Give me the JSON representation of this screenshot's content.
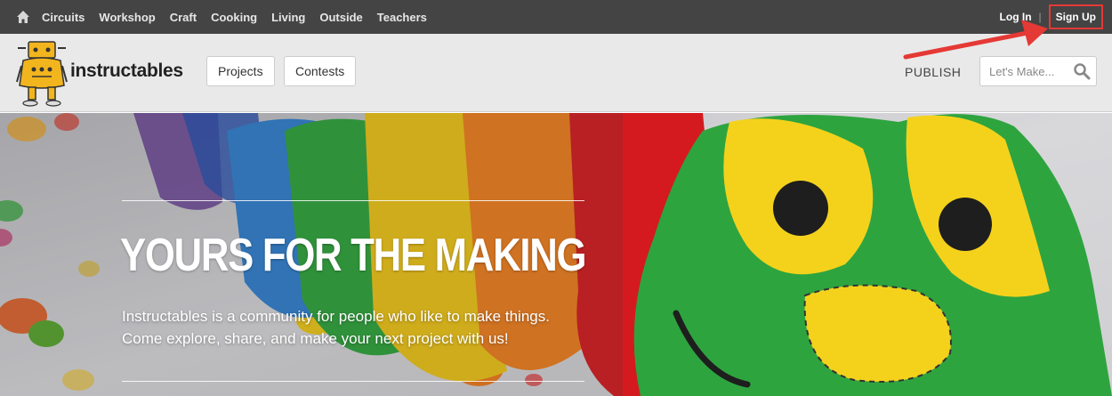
{
  "topbar": {
    "home_icon": "home-icon",
    "categories": [
      "Circuits",
      "Workshop",
      "Craft",
      "Cooking",
      "Living",
      "Outside",
      "Teachers"
    ],
    "login_label": "Log In",
    "separator": "|",
    "signup_label": "Sign Up"
  },
  "header": {
    "logo_icon": "instructables-robot-logo",
    "brand": "instructables",
    "nav": {
      "projects_label": "Projects",
      "contests_label": "Contests"
    },
    "publish_label": "PUBLISH",
    "search": {
      "placeholder": "Let's Make...",
      "value": "",
      "icon": "search-icon"
    }
  },
  "hero": {
    "title": "YOURS FOR THE MAKING",
    "desc_line1": "Instructables is a community for people who like to make things.",
    "desc_line2": "Come explore, share, and make your next project with us!"
  },
  "colors": {
    "topbar_bg": "#444444",
    "header_bg": "#e9e9e9",
    "annotation_red": "#e53935",
    "felt_green": "#27a33a",
    "felt_yellow": "#f4cf1a",
    "felt_red": "#d81b22"
  }
}
